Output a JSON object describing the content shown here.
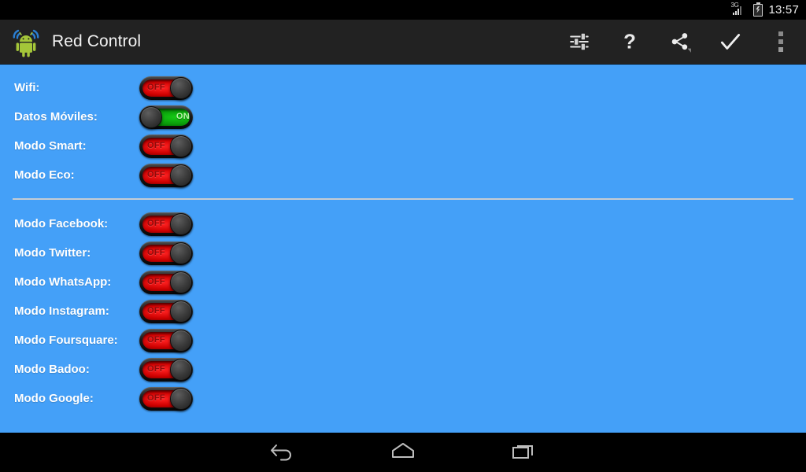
{
  "status_bar": {
    "network_label": "3G",
    "time": "13:57",
    "icons": [
      "signal-3g-icon",
      "battery-charging-icon"
    ]
  },
  "action_bar": {
    "title": "Red Control",
    "logo_icon": "android-wifi-logo",
    "actions": [
      {
        "name": "settings-sliders-button",
        "icon": "sliders-icon",
        "label": "Ajustes"
      },
      {
        "name": "help-button",
        "icon": "question-mark-icon",
        "label": "?"
      },
      {
        "name": "share-button",
        "icon": "share-icon",
        "label": "Compartir"
      },
      {
        "name": "apply-button",
        "icon": "checkmark-icon",
        "label": "Aplicar"
      },
      {
        "name": "overflow-menu-button",
        "icon": "overflow-dots-icon",
        "label": "Más opciones"
      }
    ]
  },
  "main": {
    "groups": [
      {
        "rows": [
          {
            "label": "Wifi:",
            "state": "OFF",
            "on": false
          },
          {
            "label": "Datos Móviles:",
            "state": "ON",
            "on": true
          },
          {
            "label": "Modo Smart:",
            "state": "OFF",
            "on": false
          },
          {
            "label": "Modo Eco:",
            "state": "OFF",
            "on": false
          }
        ]
      },
      {
        "rows": [
          {
            "label": "Modo Facebook:",
            "state": "OFF",
            "on": false
          },
          {
            "label": "Modo Twitter:",
            "state": "OFF",
            "on": false
          },
          {
            "label": "Modo WhatsApp:",
            "state": "OFF",
            "on": false
          },
          {
            "label": "Modo Instagram:",
            "state": "OFF",
            "on": false
          },
          {
            "label": "Modo Foursquare:",
            "state": "OFF",
            "on": false
          },
          {
            "label": "Modo Badoo:",
            "state": "OFF",
            "on": false
          },
          {
            "label": "Modo Google:",
            "state": "OFF",
            "on": false
          }
        ]
      }
    ]
  },
  "nav_bar": {
    "buttons": [
      {
        "name": "nav-back-button",
        "icon": "back-arrow-icon"
      },
      {
        "name": "nav-home-button",
        "icon": "home-icon"
      },
      {
        "name": "nav-recents-button",
        "icon": "recents-icon"
      }
    ]
  },
  "colors": {
    "background": "#44a0f8",
    "action_bar": "#222222",
    "divider": "#c5cdd4",
    "toggle_off": "#cc0000",
    "toggle_on": "#0a9c0a",
    "label_text": "#ffffff"
  }
}
